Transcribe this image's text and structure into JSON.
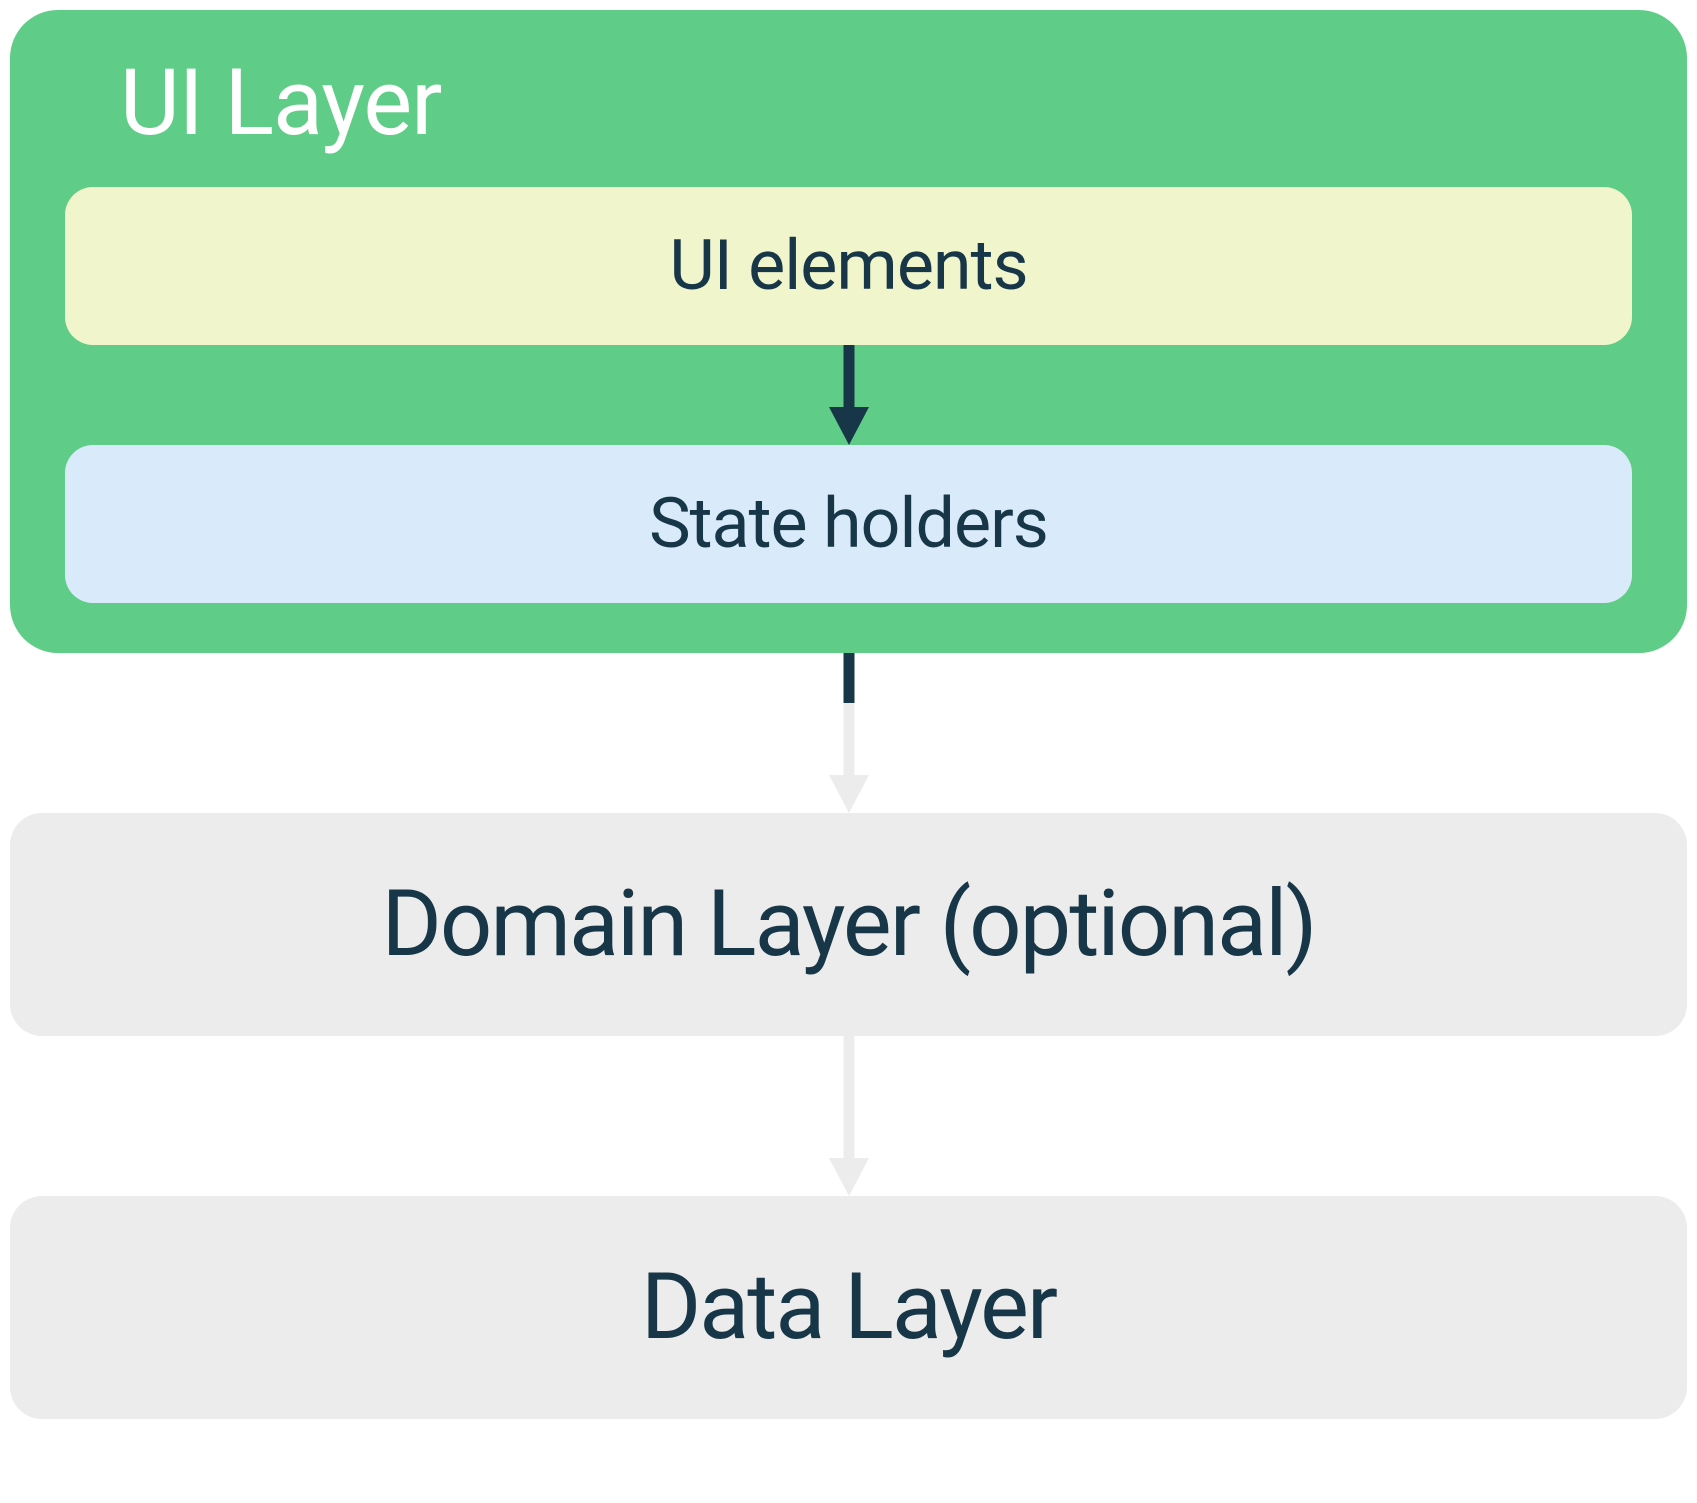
{
  "colors": {
    "ui_layer_bg": "#5fcd87",
    "ui_elements_bg": "#f1f5cb",
    "state_holders_bg": "#d9ebfa",
    "layer_bg": "#ececec",
    "text_dark": "#173647",
    "text_white": "#ffffff",
    "arrow_dark": "#173647",
    "arrow_light": "#ececec"
  },
  "ui_layer": {
    "title": "UI Layer",
    "ui_elements_label": "UI elements",
    "state_holders_label": "State holders"
  },
  "domain_layer": {
    "label": "Domain Layer (optional)"
  },
  "data_layer": {
    "label": "Data Layer"
  }
}
